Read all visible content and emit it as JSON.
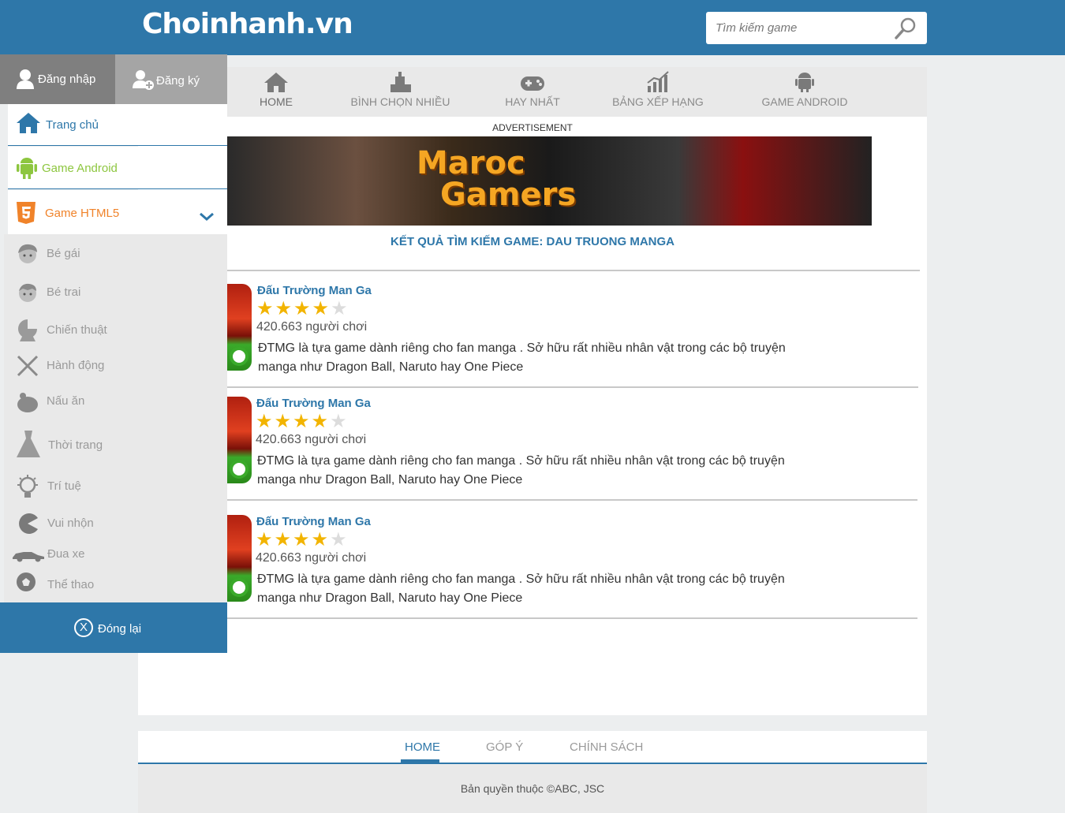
{
  "header": {
    "logo": "Choinhanh.vn",
    "search_placeholder": "Tìm kiếm game"
  },
  "topnav": [
    {
      "label": "HOME",
      "icon": "home-icon"
    },
    {
      "label": "BÌNH CHỌN NHIỀU",
      "icon": "vote-icon"
    },
    {
      "label": "HAY NHẤT",
      "icon": "gamepad-icon"
    },
    {
      "label": "BẢNG XẾP HẠNG",
      "icon": "chart-icon"
    },
    {
      "label": "GAME ANDROID",
      "icon": "android-icon"
    }
  ],
  "advertisement_label": "ADVERTISEMENT",
  "banner": {
    "line1": "Maroc",
    "line2": "Gamers"
  },
  "search_title": "KẾT QUẢ TÌM KIẾM GAME: DAU TRUONG MANGA",
  "games": [
    {
      "title": "Đấu Trường Man Ga",
      "rating": 4,
      "max_rating": 5,
      "plays": "420.663 người chơi",
      "desc_line1": "ĐTMG là tựa game dành riêng cho fan manga . Sở hữu rất nhiều nhân vật trong các bộ truyện",
      "desc_line2": "manga như Dragon Ball, Naruto hay One Piece"
    },
    {
      "title": "Đấu Trường Man Ga",
      "rating": 4,
      "max_rating": 5,
      "plays": "420.663 người chơi",
      "desc_line1": "ĐTMG là tựa game dành riêng cho fan manga . Sở hữu rất nhiều nhân vật trong các bộ truyện",
      "desc_line2": "manga như Dragon Ball, Naruto hay One Piece"
    },
    {
      "title": "Đấu Trường Man Ga",
      "rating": 4,
      "max_rating": 5,
      "plays": "420.663 người chơi",
      "desc_line1": "ĐTMG là tựa game dành riêng cho fan manga . Sở hữu rất nhiều nhân vật trong các bộ truyện",
      "desc_line2": "manga như Dragon Ball, Naruto hay One Piece"
    }
  ],
  "sidebar": {
    "login": "Đăng nhập",
    "register": "Đăng ký",
    "main_items": [
      {
        "label": "Trang chủ",
        "color": "#2e77a9",
        "icon": "home-icon"
      },
      {
        "label": "Game Android",
        "color": "#8dc63f",
        "icon": "android-icon"
      },
      {
        "label": "Game HTML5",
        "color": "#f0832a",
        "icon": "html5-icon"
      }
    ],
    "sub_items": [
      {
        "label": "Bé gái",
        "icon": "girl-icon"
      },
      {
        "label": "Bé trai",
        "icon": "boy-icon"
      },
      {
        "label": "Chiến thuật",
        "icon": "strategy-icon"
      },
      {
        "label": "Hành động",
        "icon": "swords-icon"
      },
      {
        "label": "Nấu ăn",
        "icon": "cooking-icon"
      },
      {
        "label": "Thời trang",
        "icon": "dress-icon"
      },
      {
        "label": "Trí tuệ",
        "icon": "lightbulb-icon"
      },
      {
        "label": "Vui nhộn",
        "icon": "pacman-icon"
      },
      {
        "label": "Đua xe",
        "icon": "car-icon"
      },
      {
        "label": "Thể thao",
        "icon": "ball-icon"
      }
    ],
    "close_label": "Đóng lại",
    "close_icon_text": "X"
  },
  "footer": {
    "nav": [
      "HOME",
      "GÓP Ý",
      "CHÍNH SÁCH"
    ],
    "copyright": "Bản quyền thuộc ©ABC, JSC"
  },
  "colors": {
    "brand": "#2e77a9",
    "android": "#8dc63f",
    "html5": "#f0832a",
    "star": "#f2b400"
  }
}
